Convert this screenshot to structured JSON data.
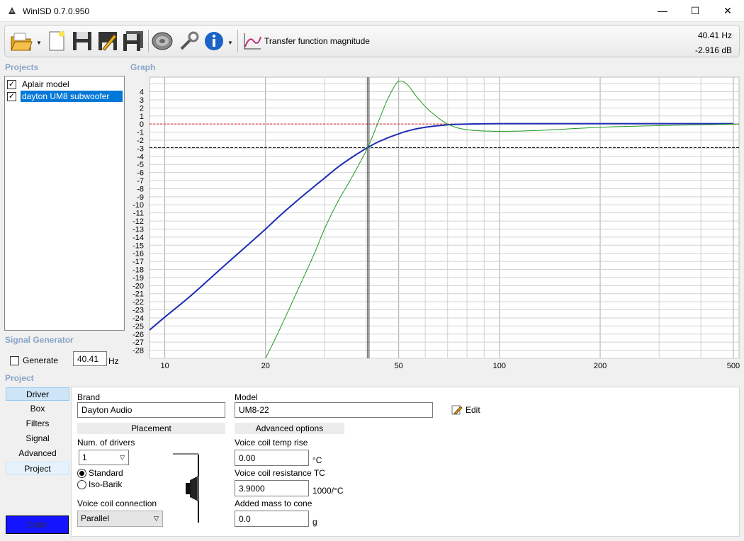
{
  "window": {
    "title": "WinISD 0.7.0.950",
    "minimize": "—",
    "maximize": "☐",
    "close": "✕"
  },
  "toolbar": {
    "graph_type_label": "Transfer function magnitude",
    "readout_frequency": "40.41 Hz",
    "readout_level": "-2.916 dB",
    "buttons": [
      "open-folder-icon",
      "new-project-icon",
      "save-icon",
      "edit-project-icon",
      "save-all-icon",
      "driver-icon",
      "tools-icon",
      "info-icon",
      "graph-icon"
    ]
  },
  "projects": {
    "label": "Projects",
    "items": [
      {
        "name": "Aplair model",
        "checked": true,
        "selected": false
      },
      {
        "name": "dayton UM8 subwoofer",
        "checked": true,
        "selected": true
      }
    ]
  },
  "graph": {
    "label": "Graph"
  },
  "signal_generator": {
    "label": "Signal Generator",
    "generate_label": "Generate",
    "frequency_value": "40.41",
    "unit": "Hz"
  },
  "project_nav": {
    "label": "Project",
    "items": [
      "Driver",
      "Box",
      "Filters",
      "Signal",
      "Advanced",
      "Project"
    ],
    "active": "Driver",
    "color_button": "Color"
  },
  "driver": {
    "brand_label": "Brand",
    "brand_value": "Dayton Audio",
    "model_label": "Model",
    "model_value": "UM8-22",
    "edit_label": "Edit",
    "placement_header": "Placement",
    "advanced_header": "Advanced options",
    "num_drivers_label": "Num. of drivers",
    "num_drivers_value": "1",
    "radio_standard": "Standard",
    "radio_isobarik": "Iso-Barik",
    "coil_connection_label": "Voice coil connection",
    "coil_connection_value": "Parallel",
    "vc_temp_label": "Voice coil temp rise",
    "vc_temp_value": "0.00",
    "vc_temp_unit": "°C",
    "vc_res_label": "Voice coil resistance TC",
    "vc_res_value": "3.9000",
    "vc_res_unit": "1000/°C",
    "added_mass_label": "Added mass to cone",
    "added_mass_value": "0.0",
    "added_mass_unit": "g"
  },
  "chart_data": {
    "type": "line",
    "title": "",
    "xlabel": "",
    "ylabel": "",
    "x_scale": "log",
    "xlim": [
      9,
      520
    ],
    "ylim": [
      -29,
      5.8
    ],
    "x_ticks": [
      10,
      20,
      50,
      100,
      200,
      500
    ],
    "y_ticks": [
      4,
      3,
      2,
      1,
      0,
      -1,
      -2,
      -3,
      -4,
      -5,
      -6,
      -7,
      -8,
      -9,
      -10,
      -11,
      -12,
      -13,
      -14,
      -15,
      -16,
      -17,
      -18,
      -19,
      -20,
      -21,
      -22,
      -23,
      -24,
      -25,
      -26,
      -27,
      -28
    ],
    "grid": true,
    "cursor": {
      "x": 40.41,
      "y": -2.916
    },
    "reference_line": {
      "y": 0,
      "color": "#e02020"
    },
    "series": [
      {
        "color": "#1c2db5",
        "x": [
          9,
          10,
          12,
          15,
          18,
          20,
          22,
          25,
          28,
          30,
          33,
          36,
          40.41,
          44,
          50,
          55,
          60,
          70,
          80,
          100,
          150,
          200,
          300,
          500
        ],
        "y": [
          -25.5,
          -23.9,
          -21.2,
          -17.6,
          -14.7,
          -13.0,
          -11.4,
          -9.4,
          -7.7,
          -6.7,
          -5.3,
          -4.2,
          -2.9,
          -2.1,
          -1.2,
          -0.7,
          -0.4,
          -0.1,
          0.0,
          0.05,
          0.05,
          0.05,
          0.05,
          0.05
        ]
      },
      {
        "color": "#1e9a1e",
        "x": [
          20,
          22,
          25,
          28,
          30,
          33,
          36,
          40.41,
          43,
          46,
          48,
          50,
          53,
          57,
          62,
          70,
          80,
          100,
          130,
          200,
          300,
          520
        ],
        "y": [
          -29.0,
          -25.5,
          -20.5,
          -16.0,
          -13.0,
          -9.5,
          -6.8,
          -2.9,
          -0.2,
          2.8,
          4.3,
          5.3,
          4.9,
          3.2,
          1.6,
          0.0,
          -0.7,
          -0.9,
          -0.8,
          -0.4,
          -0.2,
          0.0
        ]
      }
    ]
  }
}
